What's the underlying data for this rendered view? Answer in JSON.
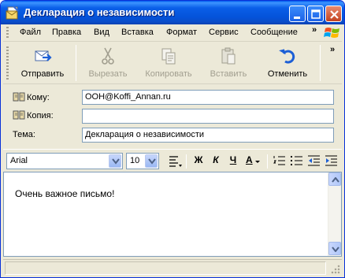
{
  "window": {
    "title": "Декларация о независимости"
  },
  "menu": {
    "items": [
      "Файл",
      "Правка",
      "Вид",
      "Вставка",
      "Формат",
      "Сервис",
      "Сообщение"
    ],
    "more": "»"
  },
  "toolbar": {
    "send": "Отправить",
    "cut": "Вырезать",
    "copy": "Копировать",
    "paste": "Вставить",
    "undo": "Отменить",
    "more": "»"
  },
  "headers": {
    "to_label": "Кому:",
    "to_value": "OOH@Koffi_Annan.ru",
    "cc_label": "Копия:",
    "cc_value": "",
    "subject_label": "Тема:",
    "subject_value": "Декларация о независимости"
  },
  "format": {
    "font": "Arial",
    "size": "10",
    "bold": "Ж",
    "italic": "К",
    "underline": "Ч",
    "color": "А"
  },
  "editor": {
    "text": "Очень важное письмо!"
  },
  "colors": {
    "titlebar": "#0453d9",
    "accent_blue": "#1c5fd6",
    "chrome": "#ece9d8"
  }
}
